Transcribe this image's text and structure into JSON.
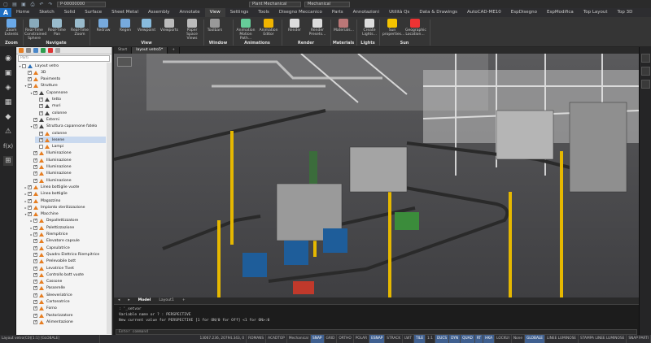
{
  "titlebar": {
    "file_field": "P-00000000",
    "workspace": "Plant Mechanical",
    "profile": "Mechanical"
  },
  "menu": {
    "logo": "A",
    "tabs": [
      "Home",
      "Sketch",
      "Solid",
      "Surface",
      "Sheet Metal",
      "Assembly",
      "Annotate",
      "View",
      "Settings",
      "Tools",
      "Disegno Meccanico",
      "Parts",
      "Annotazioni",
      "Utilità Qs",
      "Data & Drawings",
      "AutoCAD-ME10",
      "EspDisegno",
      "EspModifica",
      "Top Layout",
      "Top 3D"
    ],
    "active": "View"
  },
  "ribbon": {
    "buttons": [
      {
        "label": "Zoom Extents",
        "color": "#6aa9e8"
      },
      {
        "label": "Real-Time Constrained Sphere",
        "color": "#8ab"
      },
      {
        "label": "Real-Time Pan",
        "color": "#9bc"
      },
      {
        "label": "Real-Time Zoom",
        "color": "#9bc"
      },
      {
        "label": "Redraw",
        "color": "#7ad"
      },
      {
        "label": "Regen",
        "color": "#7ad"
      },
      {
        "label": "Viewpoint",
        "color": "#8bd"
      },
      {
        "label": "Viewports",
        "color": "#bbb"
      },
      {
        "label": "Paper Space Views",
        "color": "#bbb"
      },
      {
        "label": "Toolbars",
        "color": "#999"
      },
      {
        "label": "Animation Motion Path...",
        "color": "#6c9"
      },
      {
        "label": "Animation Editor",
        "color": "#f0b400"
      },
      {
        "label": "Render",
        "color": "#ddd"
      },
      {
        "label": "Render Presets...",
        "color": "#ddd"
      },
      {
        "label": "Materials...",
        "color": "#b77"
      },
      {
        "label": "Create Lights...",
        "color": "#ddd"
      },
      {
        "label": "Sun properties...",
        "color": "#f5c400"
      },
      {
        "label": "Geographic Location...",
        "color": "#e33"
      }
    ],
    "groups": [
      "Zoom",
      "Navigate",
      "View",
      "Window",
      "Animations",
      "Render",
      "Materials",
      "Lights",
      "Sun"
    ]
  },
  "tree": {
    "search_placeholder": "Parti",
    "items": [
      {
        "label": "Layout vetro",
        "indent": 0,
        "icon": "blue",
        "exp": "▾",
        "chk": false
      },
      {
        "label": "3D",
        "indent": 1,
        "icon": "orange",
        "exp": "",
        "chk": true
      },
      {
        "label": "Pavimento",
        "indent": 1,
        "icon": "orange",
        "exp": "",
        "chk": true
      },
      {
        "label": "Strutture",
        "indent": 1,
        "icon": "orange",
        "exp": "▾",
        "chk": true
      },
      {
        "label": "Capannone",
        "indent": 2,
        "icon": "dark",
        "exp": "▾",
        "chk": true
      },
      {
        "label": "tetto",
        "indent": 3,
        "icon": "dark",
        "exp": "",
        "chk": true
      },
      {
        "label": "muri",
        "indent": 3,
        "icon": "dark",
        "exp": "",
        "chk": true
      },
      {
        "label": "colonne",
        "indent": 3,
        "icon": "dark",
        "exp": "",
        "chk": true
      },
      {
        "label": "Esterni",
        "indent": 2,
        "icon": "dark",
        "exp": "",
        "chk": true
      },
      {
        "label": "Struttura capannone fatelo",
        "indent": 2,
        "icon": "dark",
        "exp": "▾",
        "chk": true
      },
      {
        "label": "colonne",
        "indent": 3,
        "icon": "orange",
        "exp": "",
        "chk": true
      },
      {
        "label": "lesene",
        "indent": 3,
        "icon": "orange",
        "exp": "",
        "chk": true,
        "selected": true
      },
      {
        "label": "Lampi",
        "indent": 3,
        "icon": "orange",
        "exp": "",
        "chk": false
      },
      {
        "label": "Illuminazione",
        "indent": 2,
        "icon": "orange",
        "exp": "",
        "chk": true
      },
      {
        "label": "Illuminazione",
        "indent": 2,
        "icon": "orange",
        "exp": "",
        "chk": true
      },
      {
        "label": "Illuminazione",
        "indent": 2,
        "icon": "orange",
        "exp": "",
        "chk": true
      },
      {
        "label": "Illuminazione",
        "indent": 2,
        "icon": "orange",
        "exp": "",
        "chk": true
      },
      {
        "label": "Illuminazione",
        "indent": 2,
        "icon": "orange",
        "exp": "",
        "chk": true
      },
      {
        "label": "Linea bottiglie vuote",
        "indent": 1,
        "icon": "orange",
        "exp": "▸",
        "chk": true
      },
      {
        "label": "Linea bottiglie",
        "indent": 1,
        "icon": "orange",
        "exp": "▸",
        "chk": true
      },
      {
        "label": "Magazzino",
        "indent": 1,
        "icon": "orange",
        "exp": "▸",
        "chk": true
      },
      {
        "label": "Impianto sterilizzazione",
        "indent": 1,
        "icon": "orange",
        "exp": "▸",
        "chk": true
      },
      {
        "label": "Macchine",
        "indent": 1,
        "icon": "orange",
        "exp": "▾",
        "chk": true
      },
      {
        "label": "Depallettizzatore",
        "indent": 2,
        "icon": "orange",
        "exp": "▸",
        "chk": true
      },
      {
        "label": "Palettizzazione",
        "indent": 2,
        "icon": "orange",
        "exp": "▸",
        "chk": true
      },
      {
        "label": "Riempitrice",
        "indent": 2,
        "icon": "orange",
        "exp": "▸",
        "chk": true
      },
      {
        "label": "Elevatore capsule",
        "indent": 2,
        "icon": "orange",
        "exp": "",
        "chk": true
      },
      {
        "label": "Capsulatrice",
        "indent": 2,
        "icon": "orange",
        "exp": "",
        "chk": true
      },
      {
        "label": "Quadro Elettrico Riempitrice",
        "indent": 2,
        "icon": "orange",
        "exp": "",
        "chk": true
      },
      {
        "label": "Prelevabile bott",
        "indent": 2,
        "icon": "orange",
        "exp": "",
        "chk": true
      },
      {
        "label": "Levatrice Tivet",
        "indent": 2,
        "icon": "orange",
        "exp": "",
        "chk": true
      },
      {
        "label": "Controllo bott vuote",
        "indent": 2,
        "icon": "orange",
        "exp": "",
        "chk": true
      },
      {
        "label": "Cassone",
        "indent": 2,
        "icon": "orange",
        "exp": "",
        "chk": true
      },
      {
        "label": "Passerelle",
        "indent": 2,
        "icon": "orange",
        "exp": "",
        "chk": true
      },
      {
        "label": "Sleeveriatrice",
        "indent": 2,
        "icon": "orange",
        "exp": "",
        "chk": true
      },
      {
        "label": "Cartonatrice",
        "indent": 2,
        "icon": "orange",
        "exp": "",
        "chk": true
      },
      {
        "label": "Forno",
        "indent": 2,
        "icon": "orange",
        "exp": "",
        "chk": true
      },
      {
        "label": "Pastorizzatore",
        "indent": 2,
        "icon": "orange",
        "exp": "",
        "chk": true
      },
      {
        "label": "Alimentazione",
        "indent": 2,
        "icon": "orange",
        "exp": "",
        "chk": true
      }
    ]
  },
  "doc_tabs": [
    "Start",
    "layout vetro5*",
    "+"
  ],
  "layout_tabs": [
    "◂",
    "▸",
    "Model",
    "Layout1",
    "+"
  ],
  "command": {
    "lines": [
      ": '_setvar",
      "Variable name or ? : PERSPECTIVE",
      "New current value for PERSPECTIVE [1 for ON/0 for Off] <1 for ON>:0"
    ],
    "input_placeholder": "Enter command"
  },
  "status": {
    "left": "Layout vetro(C0)[1:1] [GLOBALE]",
    "coords": "13067.236, 20794.343, 0",
    "items": [
      "ROMANS",
      "ACADTOP",
      "Mechanical",
      "SNAP",
      "GRID",
      "ORTHO",
      "POLAR",
      "ESNAP",
      "STRACK",
      "LWT",
      "TILE",
      "1:1",
      "DUCS",
      "DYN",
      "QUAD",
      "RT",
      "HKA",
      "LOCKUI",
      "None",
      "GLOBALE",
      "LINEE LUMINOSE",
      "STAMPA LINEE LUMINOSE",
      "SNAP PARTI"
    ],
    "on": [
      "SNAP",
      "ESNAP",
      "TILE",
      "DUCS",
      "DYN",
      "QUAD",
      "RT",
      "HKA",
      "GLOBALE"
    ]
  }
}
